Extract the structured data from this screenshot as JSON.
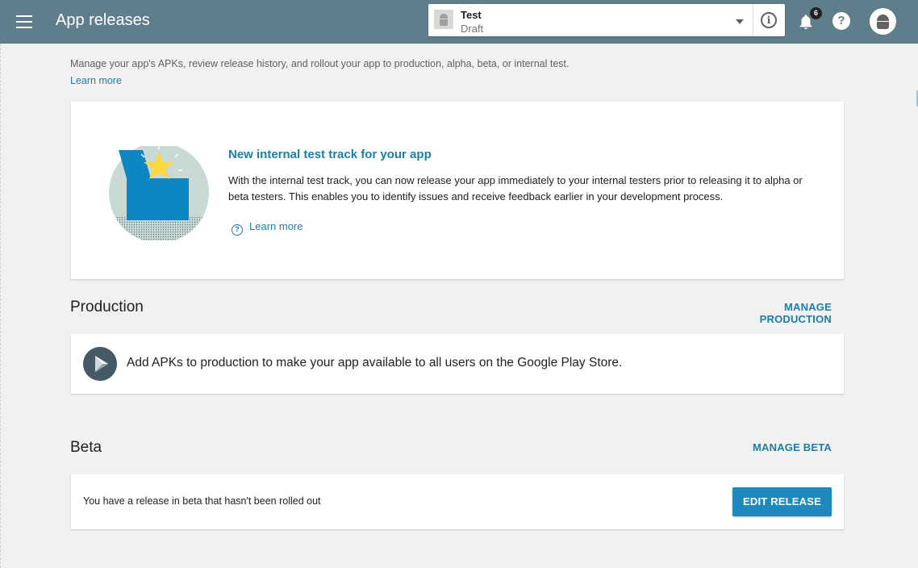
{
  "header": {
    "title": "App releases",
    "notification_count": "6",
    "help_glyph": "?",
    "info_glyph": "i"
  },
  "app_selector": {
    "name": "Test",
    "status": "Draft"
  },
  "intro": {
    "text": "Manage your app's APKs, review release history, and rollout your app to production, alpha, beta, or internal test.",
    "link": "Learn more"
  },
  "promo": {
    "title": "New internal test track for your app",
    "body": "With the internal test track, you can now release your app immediately to your internal testers prior to releasing it to alpha or beta testers. This enables you to identify issues and receive feedback earlier in your development process.",
    "link": "Learn more",
    "link_glyph": "?"
  },
  "production": {
    "title": "Production",
    "action": "MANAGE PRODUCTION",
    "message": "Add APKs to production to make your app available to all users on the Google Play Store."
  },
  "beta": {
    "title": "Beta",
    "action": "MANAGE BETA",
    "message": "You have a release in beta that hasn't been rolled out",
    "button": "EDIT RELEASE"
  },
  "colors": {
    "topbar": "#607d8b",
    "accent": "#1a7fa6",
    "button": "#1f89bd",
    "background": "#f1f1f1"
  },
  "icons": [
    "menu-icon",
    "android-icon",
    "chevron-down-icon",
    "info-icon",
    "bell-icon",
    "help-icon",
    "avatar-icon",
    "help-circle-icon",
    "play-icon"
  ]
}
